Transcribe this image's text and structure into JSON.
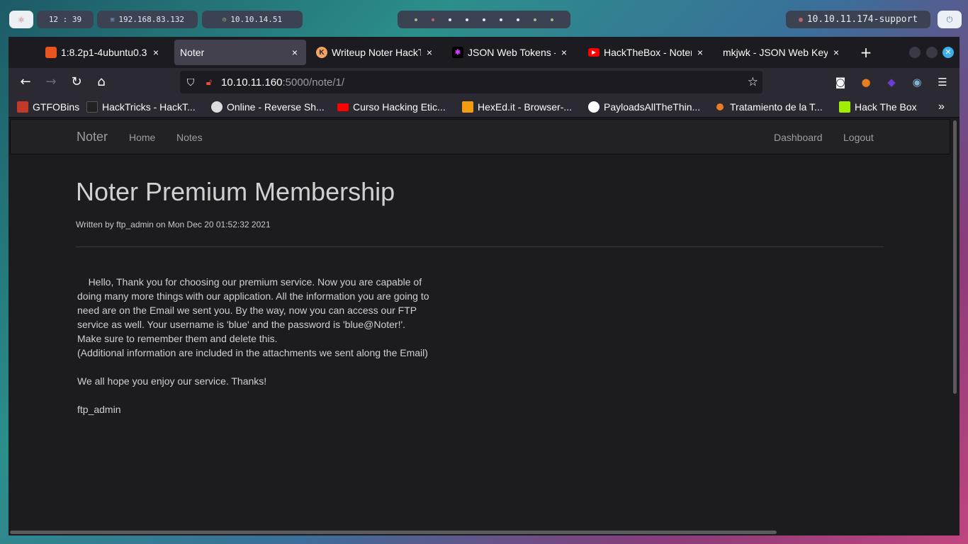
{
  "desktop": {
    "clock": "12 : 39",
    "ip_local": "192.168.83.132",
    "ip_vpn": "10.10.14.51",
    "target": "10.10.11.174-support"
  },
  "browser": {
    "tabs": [
      {
        "title": "1:8.2p1-4ubuntu0.3",
        "favicon_color": "#e95420"
      },
      {
        "title": "Noter",
        "favicon_color": ""
      },
      {
        "title": "Writeup Noter HackT",
        "favicon_color": "#f4a261"
      },
      {
        "title": "JSON Web Tokens - jw",
        "favicon_color": "#000000"
      },
      {
        "title": "HackTheBox - Noter",
        "favicon_color": "#ff0000"
      },
      {
        "title": "mkjwk - JSON Web Key",
        "favicon_color": ""
      }
    ],
    "url_host": "10.10.11.160",
    "url_path": ":5000/note/1/",
    "bookmarks": [
      {
        "label": "GTFOBins",
        "icon_color": "#c0392b"
      },
      {
        "label": "HackTricks - HackT...",
        "icon_color": "#222222"
      },
      {
        "label": "Online - Reverse Sh...",
        "icon_color": "#dddddd"
      },
      {
        "label": "Curso Hacking Etic...",
        "icon_color": "#ff0000"
      },
      {
        "label": "HexEd.it - Browser-...",
        "icon_color": "#f39c12"
      },
      {
        "label": "PayloadsAllTheThin...",
        "icon_color": "#ffffff"
      },
      {
        "label": "Tratamiento de la T...",
        "icon_color": "#e67e22"
      },
      {
        "label": "Hack The Box",
        "icon_color": "#9fef00"
      }
    ]
  },
  "site": {
    "brand": "Noter",
    "nav_home": "Home",
    "nav_notes": "Notes",
    "nav_dashboard": "Dashboard",
    "nav_logout": "Logout"
  },
  "note": {
    "title": "Noter Premium Membership",
    "byline": "Written by ftp_admin on Mon Dec 20 01:52:32 2021",
    "paragraphs": [
      "    Hello, Thank you for choosing our premium service. Now you are capable of doing many more things with our application. All the information you are going to need are on the Email we sent you. By the way, now you can access our FTP service as well. Your username is 'blue' and the password is 'blue@Noter!'.\nMake sure to remember them and delete this.\n(Additional information are included in the attachments we sent along the Email)",
      "We all hope you enjoy our service. Thanks!",
      "ftp_admin"
    ]
  }
}
